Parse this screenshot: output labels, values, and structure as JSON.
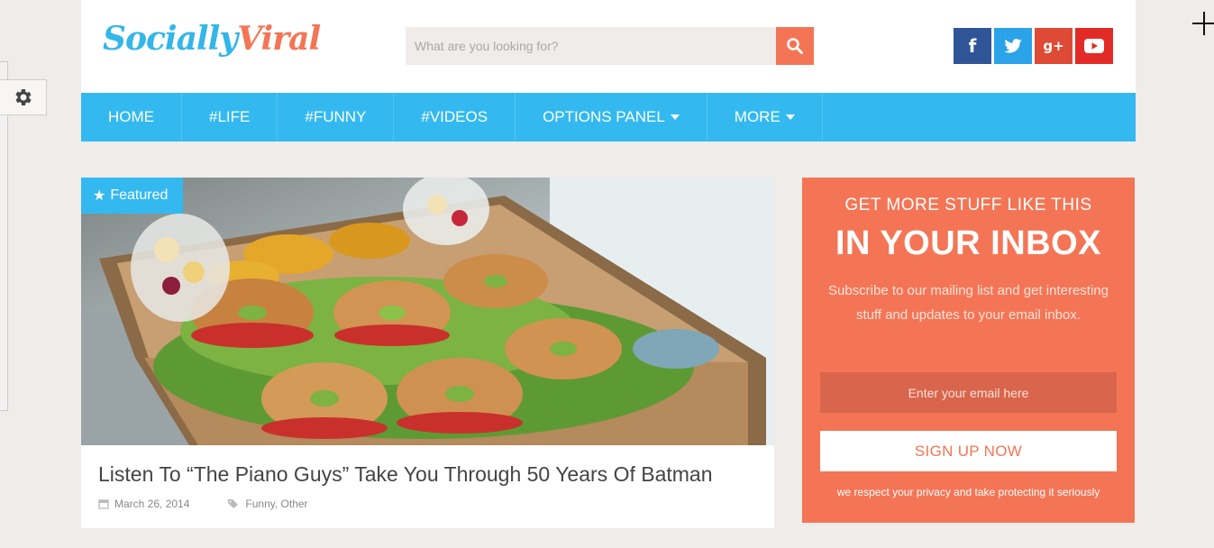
{
  "header": {
    "logo_part1": "Socially",
    "logo_part2": "Viral",
    "search_placeholder": "What are you looking for?",
    "social": [
      "facebook",
      "twitter",
      "google-plus",
      "youtube"
    ],
    "social_labels": {
      "facebook": "f",
      "google_plus": "g+"
    }
  },
  "nav": {
    "items": [
      {
        "label": "HOME"
      },
      {
        "label": "#LIFE"
      },
      {
        "label": "#FUNNY"
      },
      {
        "label": "#VIDEOS"
      },
      {
        "label": "OPTIONS PANEL",
        "dropdown": true
      },
      {
        "label": "MORE",
        "dropdown": true
      }
    ]
  },
  "post": {
    "badge": "Featured",
    "title": "Listen To “The Piano Guys” Take You Through 50 Years Of Batman",
    "date": "March 26, 2014",
    "categories": "Funny, Other"
  },
  "subscribe": {
    "kicker": "GET MORE STUFF LIKE THIS",
    "headline": "IN YOUR INBOX",
    "description": "Subscribe to our mailing list and get interesting stuff and updates to your email inbox.",
    "email_placeholder": "Enter your email here",
    "button": "SIGN UP NOW",
    "note": "we respect your privacy and take protecting it seriously"
  },
  "colors": {
    "accent_blue": "#33b9f0",
    "accent_orange": "#f47555",
    "facebook": "#2f5597",
    "twitter": "#2aa3e9",
    "google_plus": "#df4a36",
    "youtube": "#e22b26"
  }
}
